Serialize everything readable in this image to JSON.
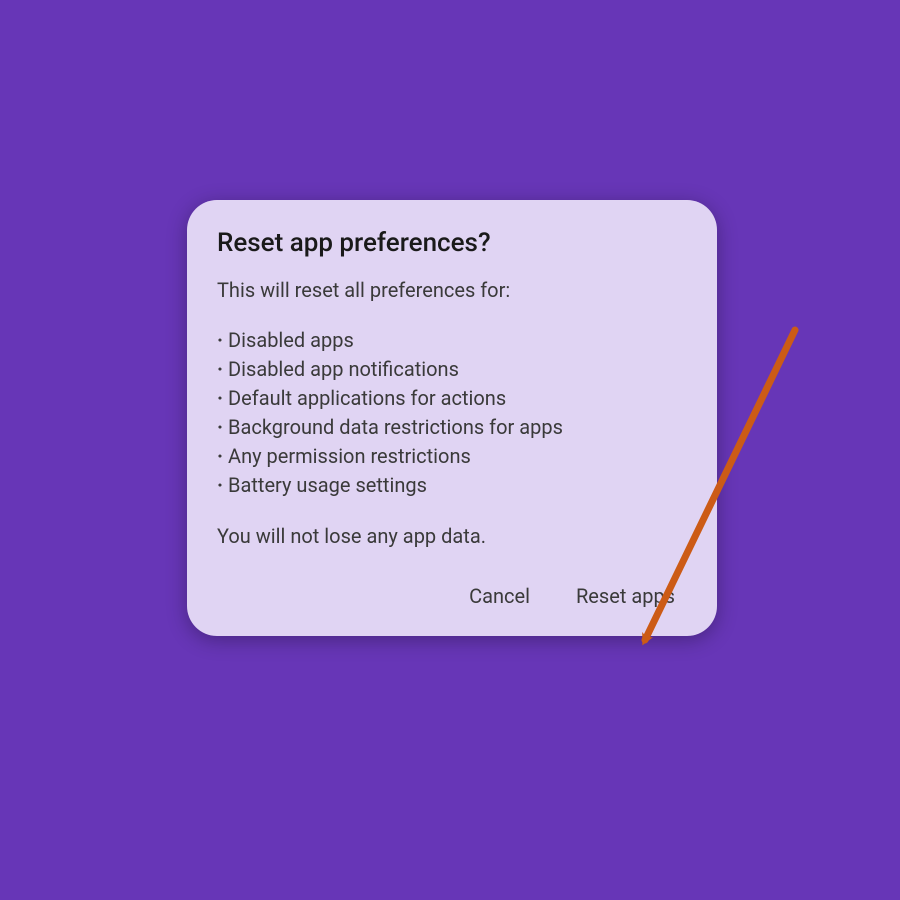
{
  "dialog": {
    "title": "Reset app preferences?",
    "intro": "This will reset all preferences for:",
    "items": [
      "Disabled apps",
      "Disabled app notifications",
      "Default applications for actions",
      "Background data restrictions for apps",
      "Any permission restrictions",
      "Battery usage settings"
    ],
    "footer": "You will not lose any app data.",
    "cancel_label": "Cancel",
    "confirm_label": "Reset apps"
  },
  "annotation": {
    "type": "arrow",
    "color": "#cc5b16",
    "target": "reset-apps-button"
  }
}
